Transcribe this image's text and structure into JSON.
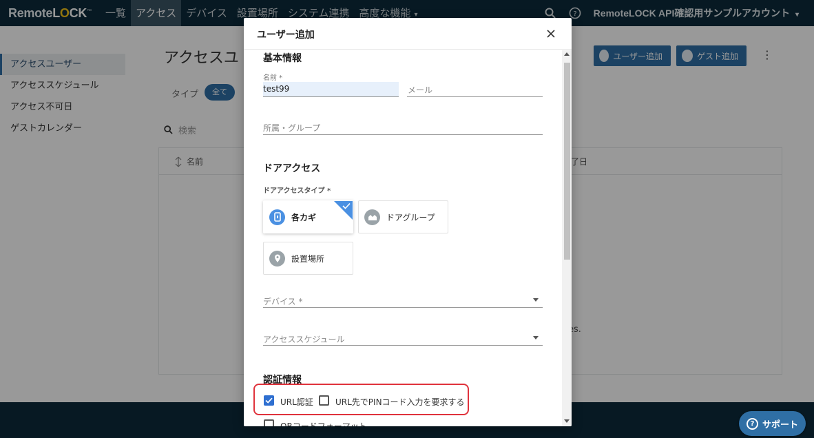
{
  "topnav": {
    "logo_text": "RemoteLOCK",
    "items": [
      "一覧",
      "アクセス",
      "デバイス",
      "設置場所",
      "システム連携",
      "高度な機能"
    ],
    "active_index": 1,
    "account_name": "RemoteLOCK API確認用サンプルアカウント",
    "search_icon": "search-icon",
    "help_icon": "help-icon"
  },
  "sidebar": {
    "items": [
      "アクセスユーザー",
      "アクセススケジュール",
      "アクセス不可日",
      "ゲストカレンダー"
    ],
    "active_index": 0
  },
  "background": {
    "title": "アクセスユ",
    "type_label": "タイプ",
    "type_chip": "全て",
    "search_placeholder": "検索",
    "col_name": "名前",
    "col_end_partial": "了日",
    "empty_text_partial": "es.",
    "add_user_button": "ユーザー追加",
    "add_guest_button": "ゲスト追加"
  },
  "modal": {
    "title": "ユーザー追加",
    "basic_info": {
      "heading": "基本情報",
      "name_label": "名前 *",
      "name_value": "test99",
      "email_placeholder": "メール",
      "group_placeholder": "所属・グループ"
    },
    "door_access": {
      "heading": "ドアアクセス",
      "type_label": "ドアアクセスタイプ *",
      "types": [
        "各カギ",
        "ドアグループ",
        "設置場所"
      ],
      "selected_index": 0,
      "device_placeholder": "デバイス *",
      "schedule_placeholder": "アクセススケジュール"
    },
    "auth": {
      "heading": "認証情報",
      "url_auth_label": "URL認証",
      "url_auth_checked": true,
      "pin_label": "URL先でPINコード入力を要求する",
      "pin_checked": false,
      "qr_label": "QRコードフォーマット",
      "qr_checked": false
    }
  },
  "support_label": "サポート",
  "colors": {
    "nav_bg": "#0d2b3b",
    "primary": "#2f6fa5",
    "highlight_border": "#e0323c",
    "selected_corner": "#4a90e2"
  }
}
